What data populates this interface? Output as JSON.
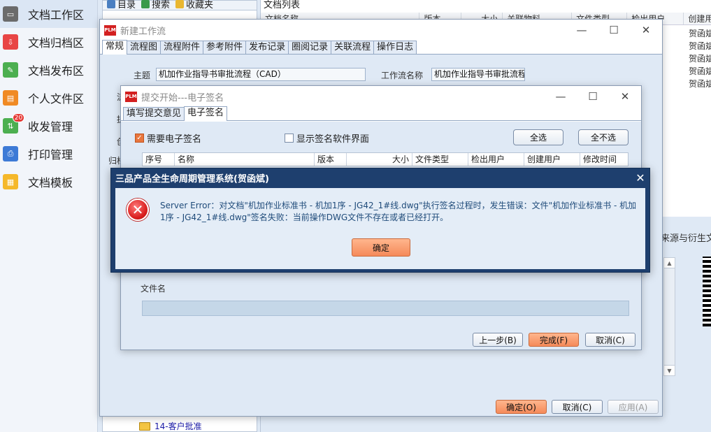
{
  "sidebar": {
    "items": [
      {
        "label": "文档工作区",
        "color": "#6b6b6b",
        "glyph": "▭"
      },
      {
        "label": "文档归档区",
        "color": "#e84545",
        "glyph": "⇩"
      },
      {
        "label": "文档发布区",
        "color": "#4caf50",
        "glyph": "✎"
      },
      {
        "label": "个人文件区",
        "color": "#f08a24",
        "glyph": "▤"
      },
      {
        "label": "收发管理",
        "color": "#4caf50",
        "glyph": "⇅",
        "badge": "20"
      },
      {
        "label": "打印管理",
        "color": "#3d7ad6",
        "glyph": "⎙"
      },
      {
        "label": "文档模板",
        "color": "#f5b82a",
        "glyph": "▦"
      }
    ]
  },
  "background": {
    "left_tabs": [
      "目录",
      "搜索",
      "收藏夹"
    ],
    "tree_item": "14-客户批准",
    "right_tab": "文档列表",
    "columns": [
      "文档名称",
      "版本",
      "大小",
      "关联物料",
      "文件类型",
      "检出用户",
      "创建用"
    ],
    "creator_cells": [
      "贺函斌",
      "贺函斌",
      "贺函斌",
      "贺函斌",
      "贺函斌"
    ],
    "lower_tab": "来源与衍生文"
  },
  "workflow": {
    "title": "新建工作流",
    "tabs": [
      "常规",
      "流程图",
      "流程附件",
      "参考附件",
      "发布记录",
      "圈阅记录",
      "关联流程",
      "操作日志"
    ],
    "subject_label": "主题",
    "subject_value": "机加作业指导书审批流程（CAD）",
    "wfname_label": "工作流名称",
    "wfname_value": "机加作业指导书审批流程",
    "side_labels": [
      "流",
      "提",
      "创",
      "归档"
    ],
    "ok": "确定(O)",
    "cancel": "取消(C)",
    "apply": "应用(A)"
  },
  "submit": {
    "title": "提交开始---电子签名",
    "tabs": [
      "填写提交意见",
      "电子签名"
    ],
    "need_sign": "需要电子签名",
    "show_sign_ui": "显示签名软件界面",
    "select_all": "全选",
    "select_none": "全不选",
    "columns": [
      "序号",
      "名称",
      "版本",
      "大小",
      "文件类型",
      "检出用户",
      "创建用户",
      "修改时间"
    ],
    "filename_label": "文件名",
    "prev": "上一步(B)",
    "finish": "完成(F)",
    "cancel": "取消(C)"
  },
  "error": {
    "title": "三品产品全生命周期管理系统(贺函斌)",
    "message": "Server Error：对文档\"机加作业标准书 - 机加1序 - JG42_1#线.dwg\"执行签名过程时，发生错误：文件\"机加作业标准书 - 机加1序 - JG42_1#线.dwg\"签名失败：当前操作DWG文件不存在或者已经打开。",
    "ok": "确定"
  }
}
